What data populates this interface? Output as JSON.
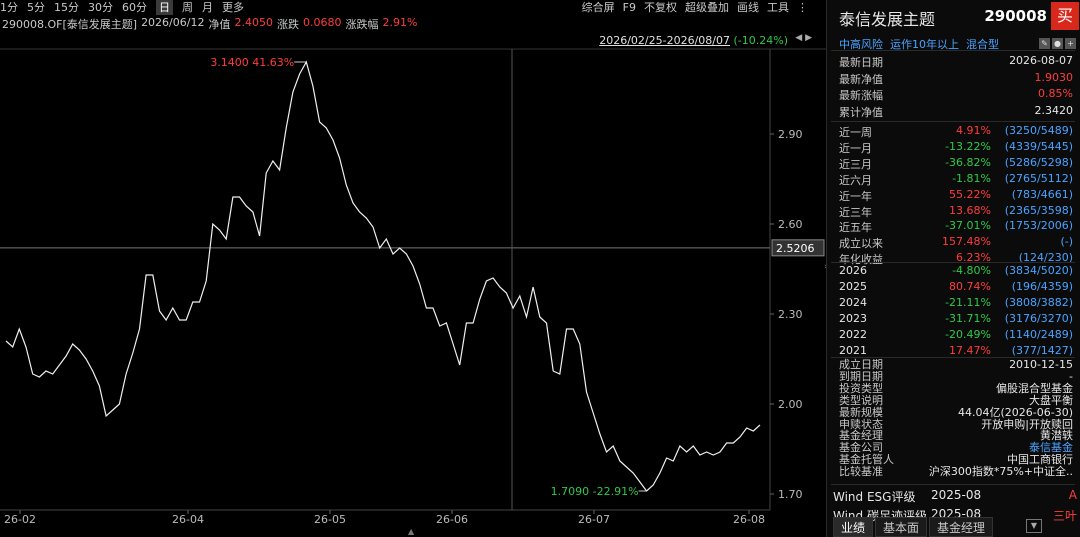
{
  "toolbar": {
    "periods": [
      "1分",
      "5分",
      "15分",
      "30分",
      "60分",
      "日",
      "周",
      "月",
      "更多"
    ],
    "active_period": "日",
    "right": [
      "综合屏",
      "F9",
      "不复权",
      "超级叠加",
      "画线",
      "工具"
    ]
  },
  "info": {
    "code_name": "290008.OF[泰信发展主题]",
    "date": "2026/06/12",
    "nav_label": "净值",
    "nav": "2.4050",
    "change_label": "涨跌",
    "change": "0.0680",
    "pct_label": "涨跌幅",
    "pct": "2.91%"
  },
  "range": {
    "dates": "2026/02/25-2026/08/07",
    "change": "(-10.24%)"
  },
  "chart_data": {
    "type": "line",
    "y_ticks": [
      2.9,
      2.6,
      2.3,
      2.0,
      1.7
    ],
    "x_ticks": [
      "26-02",
      "26-04",
      "26-05",
      "26-06",
      "26-07",
      "26-08"
    ],
    "ylim": [
      1.64,
      3.27
    ],
    "crosshair_value": "2.5206",
    "max_label": "3.1400 41.63%",
    "min_label": "1.7090 -22.91%",
    "values": [
      2.21,
      2.19,
      2.25,
      2.19,
      2.1,
      2.09,
      2.11,
      2.1,
      2.13,
      2.16,
      2.2,
      2.18,
      2.15,
      2.11,
      2.06,
      1.96,
      1.98,
      2.0,
      2.1,
      2.17,
      2.25,
      2.43,
      2.43,
      2.31,
      2.28,
      2.32,
      2.28,
      2.28,
      2.34,
      2.34,
      2.41,
      2.6,
      2.58,
      2.55,
      2.69,
      2.69,
      2.66,
      2.64,
      2.56,
      2.77,
      2.81,
      2.78,
      2.92,
      3.04,
      3.1,
      3.14,
      3.06,
      2.94,
      2.92,
      2.88,
      2.82,
      2.73,
      2.67,
      2.64,
      2.62,
      2.59,
      2.52,
      2.55,
      2.5,
      2.52,
      2.5,
      2.46,
      2.4,
      2.32,
      2.32,
      2.26,
      2.27,
      2.2,
      2.13,
      2.27,
      2.27,
      2.35,
      2.41,
      2.42,
      2.39,
      2.37,
      2.32,
      2.36,
      2.29,
      2.39,
      2.29,
      2.27,
      2.11,
      2.1,
      2.25,
      2.25,
      2.2,
      2.04,
      1.97,
      1.9,
      1.84,
      1.86,
      1.81,
      1.79,
      1.77,
      1.74,
      1.71,
      1.73,
      1.77,
      1.82,
      1.81,
      1.86,
      1.84,
      1.86,
      1.83,
      1.84,
      1.83,
      1.84,
      1.87,
      1.87,
      1.89,
      1.92,
      1.91,
      1.93
    ]
  },
  "fund": {
    "name": "泰信发展主题",
    "code": "290008",
    "buy": "买",
    "tags": [
      "中高风险",
      "运作10年以上",
      "混合型"
    ]
  },
  "latest": [
    {
      "label": "最新日期",
      "value": "2026-08-07",
      "color": "#e6e6e6"
    },
    {
      "label": "最新净值",
      "value": "1.9030",
      "color": "#ff3c3c"
    },
    {
      "label": "最新涨幅",
      "value": "0.85%",
      "color": "#ff3c3c"
    },
    {
      "label": "累计净值",
      "value": "2.3420",
      "color": "#e6e6e6"
    }
  ],
  "periods": [
    {
      "label": "近一周",
      "value": "4.91%",
      "rank": "(3250/5489)",
      "color": "#ff3c3c"
    },
    {
      "label": "近一月",
      "value": "-13.22%",
      "rank": "(4339/5445)",
      "color": "#2ec84a"
    },
    {
      "label": "近三月",
      "value": "-36.82%",
      "rank": "(5286/5298)",
      "color": "#2ec84a"
    },
    {
      "label": "近六月",
      "value": "-1.81%",
      "rank": "(2765/5112)",
      "color": "#2ec84a"
    },
    {
      "label": "近一年",
      "value": "55.22%",
      "rank": "(783/4661)",
      "color": "#ff3c3c"
    },
    {
      "label": "近三年",
      "value": "13.68%",
      "rank": "(2365/3598)",
      "color": "#ff3c3c"
    },
    {
      "label": "近五年",
      "value": "-37.01%",
      "rank": "(1753/2006)",
      "color": "#2ec84a"
    },
    {
      "label": "成立以来",
      "value": "157.48%",
      "rank": "(-)",
      "color": "#ff3c3c"
    },
    {
      "label": "年化收益",
      "value": "6.23%",
      "rank": "(124/230)",
      "color": "#ff3c3c"
    }
  ],
  "years": [
    {
      "label": "2026",
      "value": "-4.80%",
      "rank": "(3834/5020)",
      "color": "#2ec84a"
    },
    {
      "label": "2025",
      "value": "80.74%",
      "rank": "(196/4359)",
      "color": "#ff3c3c"
    },
    {
      "label": "2024",
      "value": "-21.11%",
      "rank": "(3808/3882)",
      "color": "#2ec84a"
    },
    {
      "label": "2023",
      "value": "-31.71%",
      "rank": "(3176/3270)",
      "color": "#2ec84a"
    },
    {
      "label": "2022",
      "value": "-20.49%",
      "rank": "(1140/2489)",
      "color": "#2ec84a"
    },
    {
      "label": "2021",
      "value": "17.47%",
      "rank": "(377/1427)",
      "color": "#ff3c3c"
    }
  ],
  "details": [
    {
      "label": "成立日期",
      "value": "2010-12-15",
      "color": "#e6e6e6"
    },
    {
      "label": "到期日期",
      "value": "-",
      "color": "#e6e6e6"
    },
    {
      "label": "投资类型",
      "value": "偏股混合型基金",
      "color": "#e6e6e6"
    },
    {
      "label": "类型说明",
      "value": "大盘平衡",
      "color": "#e6e6e6"
    },
    {
      "label": "最新规模",
      "value": "44.04亿(2026-06-30)",
      "color": "#e6e6e6"
    },
    {
      "label": "申赎状态",
      "value": "开放申购|开放赎回",
      "color": "#e6e6e6"
    },
    {
      "label": "基金经理",
      "value": "黄潜轶",
      "color": "#e6e6e6"
    },
    {
      "label": "基金公司",
      "value": "泰信基金",
      "color": "#4aa3ff"
    },
    {
      "label": "基金托管人",
      "value": "中国工商银行",
      "color": "#e6e6e6"
    },
    {
      "label": "比较基准",
      "value": "沪深300指数*75%+中证全..",
      "color": "#e6e6e6"
    }
  ],
  "esg": [
    {
      "label": "Wind ESG评级",
      "date": "2025-08",
      "grade": "A"
    },
    {
      "label": "Wind 碳足迹评级",
      "date": "2025-08",
      "grade": "三叶"
    }
  ],
  "tabs": [
    "业绩",
    "基本面",
    "基金经理"
  ],
  "active_tab": "业绩"
}
